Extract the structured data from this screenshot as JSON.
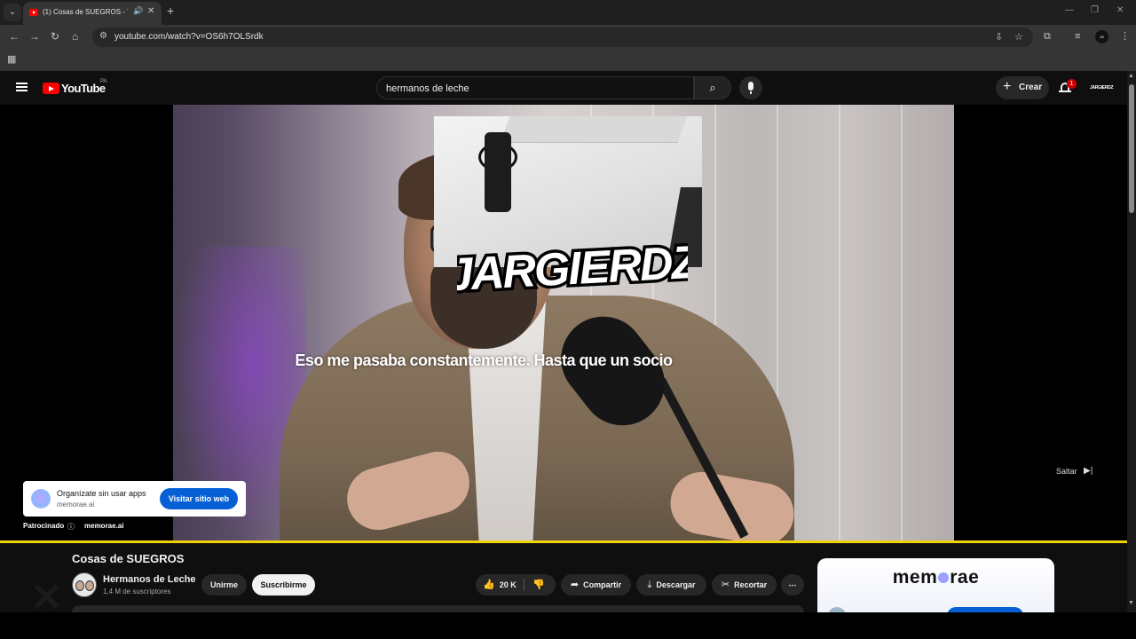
{
  "browser": {
    "tab_title": "(1) Cosas de SUEGROS - YouTube",
    "url": "youtube.com/watch?v=OS6h7OLSrdk",
    "icons": [
      "tab-dropdown-icon",
      "youtube-favicon-icon",
      "audio-icon",
      "close-icon",
      "new-tab-icon",
      "minimize-icon",
      "maximize-icon",
      "back-icon",
      "forward-icon",
      "reload-icon",
      "home-icon",
      "site-settings-icon",
      "install-app-icon",
      "bookmark-star-icon",
      "extensions-icon",
      "media-icon",
      "profile-icon",
      "menu-icon",
      "apps-icon"
    ]
  },
  "youtube": {
    "logo_text": "YouTube",
    "country_code": "PA",
    "search_query": "hermanos de leche",
    "create_label": "Crear",
    "notification_count": "1",
    "avatar_text": "JARGIERDZ"
  },
  "player": {
    "subtitle": "Eso me pasaba constantemente. Hasta que un socio",
    "overlay_logo": "JARGIERDZ",
    "skip_label": "Saltar",
    "progress_fraction": 1.0,
    "accent_color": "#f2d100"
  },
  "ad": {
    "title": "Organízate sin usar apps",
    "domain": "memorae.ai",
    "cta": "Visitar sitio web",
    "sponsored_label": "Patrocinado",
    "sponsored_domain": "memorae.ai",
    "cta_color": "#065fd4"
  },
  "video": {
    "title": "Cosas de SUEGROS",
    "channel_name": "Hermanos de Leche",
    "subscribers": "1,4 M de suscriptores",
    "join_label": "Unirme",
    "subscribe_label": "Suscribirme",
    "likes": "20 K",
    "share_label": "Compartir",
    "download_label": "Descargar",
    "clip_label": "Recortar"
  },
  "side_ad": {
    "brand_left": "mem",
    "brand_right": "rae"
  }
}
